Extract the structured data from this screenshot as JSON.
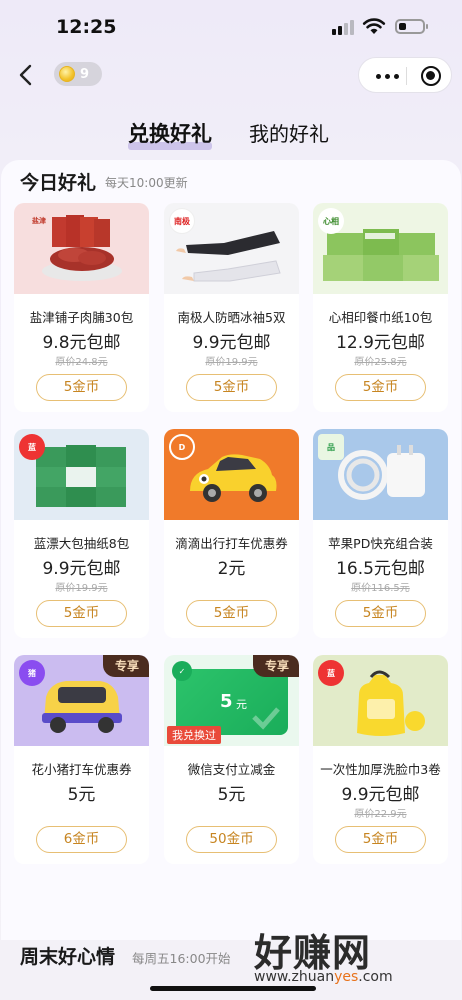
{
  "status": {
    "time": "12:25"
  },
  "nav": {
    "coin_count": "9"
  },
  "tabs": [
    {
      "label": "兑换好礼",
      "active": true
    },
    {
      "label": "我的好礼",
      "active": false
    }
  ],
  "today": {
    "title": "今日好礼",
    "subtitle": "每天10:00更新",
    "items": [
      {
        "name": "盐津铺子肉脯30包",
        "price": "9.8元包邮",
        "orig": "原价24.8元",
        "btn": "5金币"
      },
      {
        "name": "南极人防晒冰袖5双",
        "price": "9.9元包邮",
        "orig": "原价19.9元",
        "btn": "5金币",
        "badge": "南极人"
      },
      {
        "name": "心相印餐巾纸10包",
        "price": "12.9元包邮",
        "orig": "原价25.8元",
        "btn": "5金币"
      },
      {
        "name": "蓝漂大包抽纸8包",
        "price": "9.9元包邮",
        "orig": "原价19.9元",
        "btn": "5金币"
      },
      {
        "name": "滴滴出行打车优惠券",
        "price": "2元",
        "btn": "5金币"
      },
      {
        "name": "苹果PD快充组合装",
        "price": "16.5元包邮",
        "orig": "原价116.5元",
        "btn": "5金币"
      },
      {
        "name": "花小猪打车优惠券",
        "price": "5元",
        "btn": "6金币",
        "tag": "专享"
      },
      {
        "name": "微信支付立减金",
        "price": "5元",
        "btn": "50金币",
        "tag": "专享",
        "used": "我兑换过",
        "card_amount": "5",
        "card_unit": "元"
      },
      {
        "name": "一次性加厚洗脸巾3卷",
        "price": "9.9元包邮",
        "orig": "原价22.9元",
        "btn": "5金币"
      }
    ]
  },
  "weekend": {
    "title": "周末好心情",
    "subtitle": "每周五16:00开始"
  },
  "watermark": {
    "big": "好赚网",
    "url_a": "www.zhuan",
    "url_b": "yes",
    "url_c": ".com"
  }
}
